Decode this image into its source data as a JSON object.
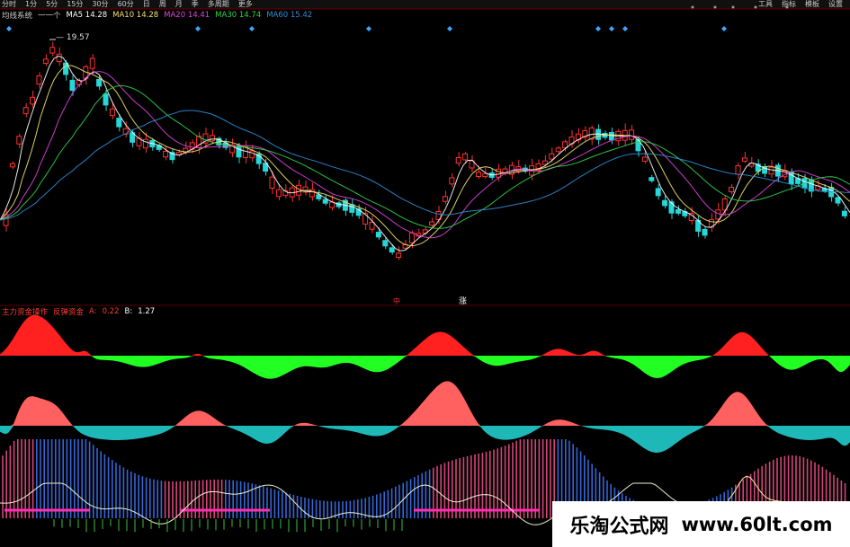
{
  "toolbar": {
    "items": [
      "分时",
      "1分",
      "5分",
      "15分",
      "30分",
      "60分",
      "日",
      "周",
      "月",
      "季",
      "多周期",
      "更多"
    ],
    "right_items": [
      "",
      "工具",
      "指标",
      "模板",
      "设置"
    ]
  },
  "ma_legend": {
    "prefix": "均线系统",
    "ticker": "一一个",
    "items": [
      {
        "label": "MA5",
        "value": "14.28",
        "color": "#ffffff"
      },
      {
        "label": "MA10",
        "value": "14.28",
        "color": "#f5e26b"
      },
      {
        "label": "MA20",
        "value": "14.41",
        "color": "#e044e0"
      },
      {
        "label": "MA30",
        "value": "14.74",
        "color": "#33d24a"
      },
      {
        "label": "MA60",
        "value": "15.42",
        "color": "#2e8fd8"
      }
    ]
  },
  "price_annotation": "19.57",
  "signal_marks": [
    "中",
    "涨"
  ],
  "indicator_legend": {
    "name": "主力资金操作",
    "label": "反弹资金",
    "a_label": "A:",
    "a_value": "0.22",
    "b_label": "B:",
    "b_value": "1.27",
    "color": "#ff3b30"
  },
  "colors": {
    "up": "#ff3030",
    "down": "#26d6d8",
    "bg": "#000000",
    "histo_pos": "#ff2020",
    "histo_neg": "#22ff22",
    "area_pos": "#ff6060",
    "area_neg": "#1fb8b8",
    "bar_pink": "#d2457a",
    "bar_blue": "#3565d6"
  },
  "watermark": {
    "cn": "乐淘公式网",
    "url": "www.60lt.com"
  }
}
